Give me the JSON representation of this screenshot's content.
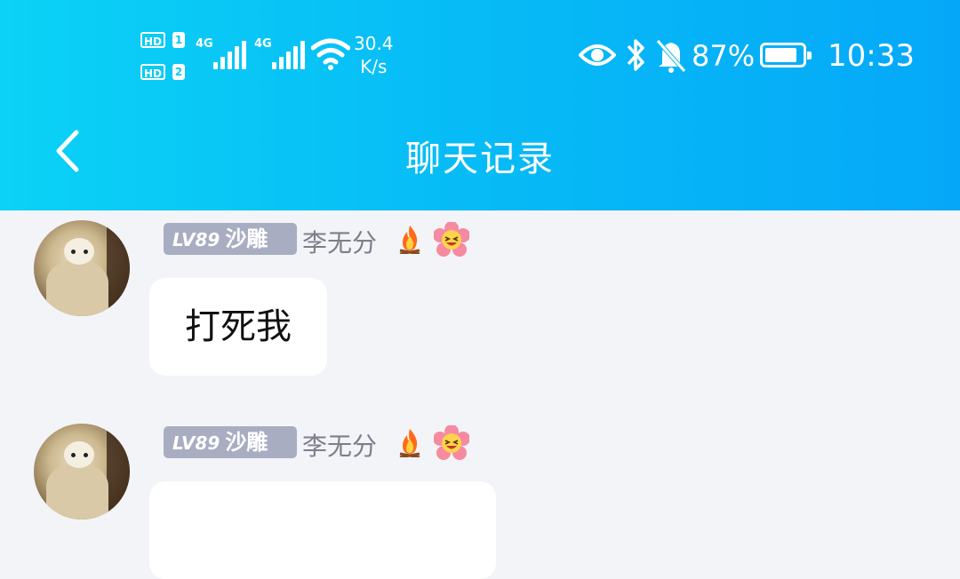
{
  "status_bar": {
    "sim1_label": "HD",
    "sim1_num": "1",
    "sim2_label": "HD",
    "sim2_num": "2",
    "net1": "4G",
    "net2": "4G",
    "speed_value": "30.4",
    "speed_unit": "K/s",
    "icons": [
      "eye-icon",
      "bluetooth-icon",
      "bell-muted-icon"
    ],
    "battery_percent": "87%",
    "battery_level": 0.87,
    "time": "10:33"
  },
  "header": {
    "title": "聊天记录",
    "back_icon": "chevron-left-icon",
    "gradient_start": "#0bd2f6",
    "gradient_end": "#05a8f8"
  },
  "messages": [
    {
      "level_prefix": "LV89",
      "level_title": "沙雕",
      "sender": "李无分",
      "badge_icons": [
        "fire-icon",
        "laughing-flower-icon"
      ],
      "text": "打死我"
    },
    {
      "level_prefix": "LV89",
      "level_title": "沙雕",
      "sender": "李无分",
      "badge_icons": [
        "fire-icon",
        "laughing-flower-icon"
      ],
      "text": ""
    }
  ],
  "colors": {
    "background": "#f3f4f8",
    "badge": "#a9adc2",
    "sender_name": "#7d7e8a"
  }
}
